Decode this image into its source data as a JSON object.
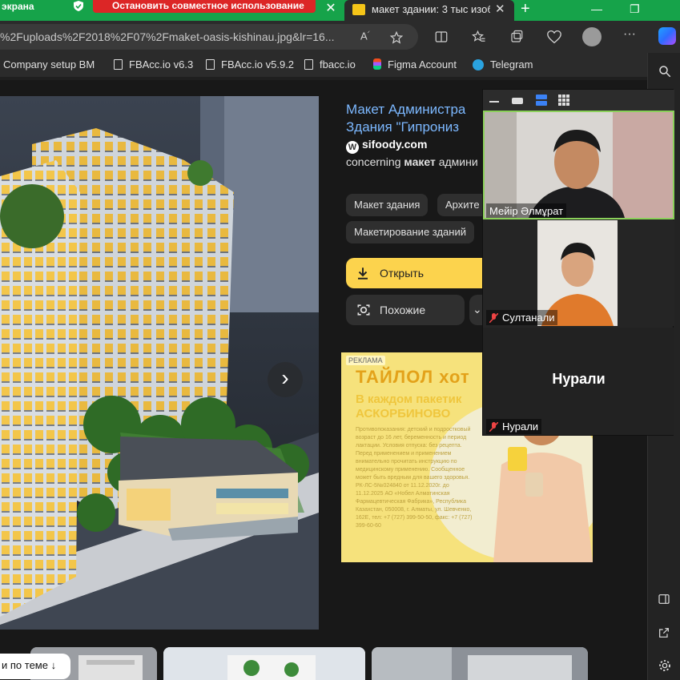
{
  "tabs": {
    "share_label": "экрана",
    "stop_share": "Остановить совместное использование",
    "active_title": "макет здании: 3 тыс изобр",
    "close_glyph": "✕",
    "new_tab_glyph": "+"
  },
  "window": {
    "minimize": "—",
    "restore": "❐"
  },
  "address": {
    "url": "%2Fuploads%2F2018%2F07%2Fmaket-oasis-kishinau.jpg&lr=16..."
  },
  "bookmarks": [
    {
      "label": "Company setup BM"
    },
    {
      "label": "FBAcc.io v6.3"
    },
    {
      "label": "FBAcc.io v5.9.2"
    },
    {
      "label": "fbacc.io"
    },
    {
      "label": "Figma Account"
    },
    {
      "label": "Telegram"
    }
  ],
  "result": {
    "title_line1": "Макет Администра",
    "title_line2": "Здания \"Гипрониз",
    "source": "sifoody.com",
    "description_pre": "concerning ",
    "description_bold": "макет",
    "description_post": " админи",
    "chips": [
      "Макет здания",
      "Архите",
      "Макетирование зданий"
    ],
    "open_label": "Открыть",
    "similar_label": "Похожие"
  },
  "ad": {
    "tag": "РЕКЛАМА",
    "brand": "ТАЙЛОЛ хот",
    "slogan": "В каждом пакетик АСКОРБИНОВО",
    "fine": "Противопоказания: детский и подростковый возраст до 16 лет, беременность и период лактации. Условия отпуска: без рецепта. Перед применением и применением внимательно прочитать инструкцию по медицинскому применению. Сообщенное может быть вредным для вашего здоровья. РК-ЛС-5№024840 от 11.12.2020г. до 11.12.2025 АО «Нобел Алматинская Фармацевтическая Фабрика», Республика Казахстан, 050008, г. Алматы, ул. Шевченко, 162Е, тел: +7 (727) 399-50-50, факс: +7 (727) 399-60-60"
  },
  "more_on_topic": "и по теме",
  "meeting": {
    "participants": [
      {
        "name": "Мейір Әлмұрат",
        "muted": false
      },
      {
        "name": "Султанали",
        "muted": true
      },
      {
        "name": "Нурали",
        "muted": true,
        "avatar_text": "Нурали"
      }
    ]
  },
  "colors": {
    "share_green": "#16a34a",
    "stop_red": "#dc2626",
    "open_yellow": "#fcd34d",
    "link_blue": "#7cb8ff"
  }
}
